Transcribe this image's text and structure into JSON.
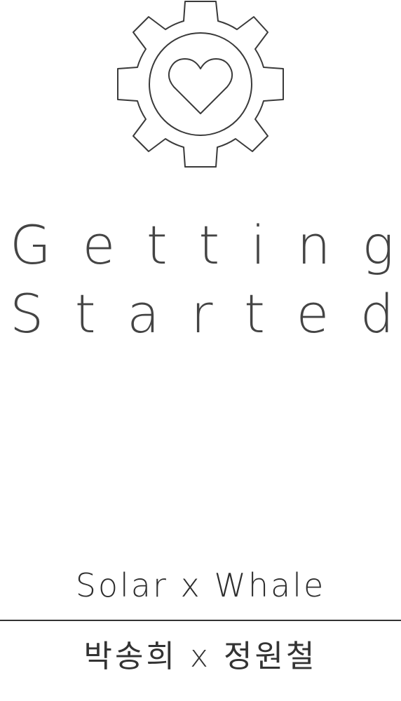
{
  "logo": {
    "icon": "gear-heart-icon",
    "stroke_color": "#3a3a3a"
  },
  "title": {
    "line1": [
      "G",
      "e",
      "t",
      "t",
      "i",
      "n",
      "g"
    ],
    "line2": [
      "S",
      "t",
      "a",
      "r",
      "t",
      "e",
      "d"
    ]
  },
  "footer": {
    "english": "Solar x Whale",
    "korean": "박송희 x 정원철"
  },
  "colors": {
    "text": "#444444",
    "divider": "#333333",
    "background": "#ffffff"
  }
}
